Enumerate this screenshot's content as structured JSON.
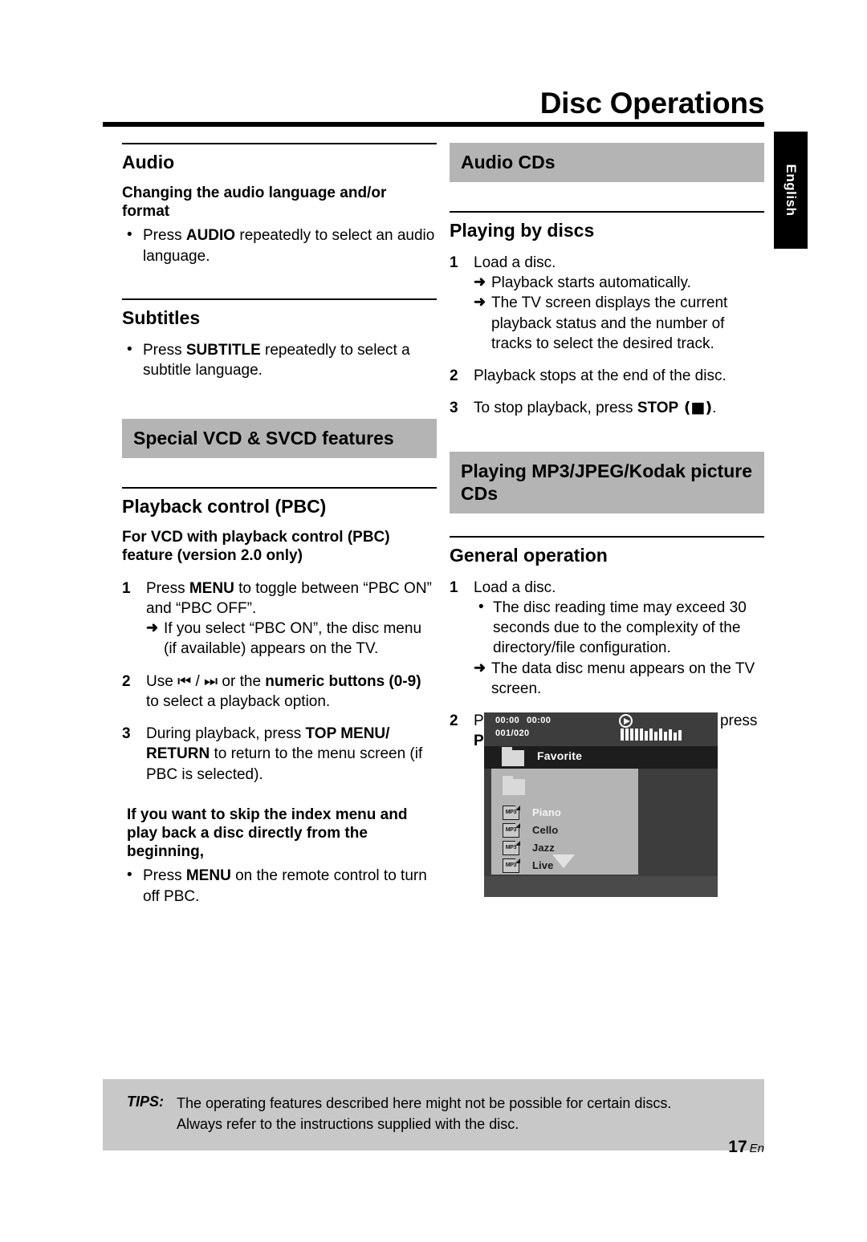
{
  "header": {
    "title": "Disc Operations",
    "language_tab": "English"
  },
  "left_column": {
    "audio": {
      "heading": "Audio",
      "sub_heading": "Changing the audio language and/or format",
      "bullet_pre": "Press ",
      "bullet_key": "AUDIO",
      "bullet_post": " repeatedly to select an audio language."
    },
    "subtitles": {
      "heading": "Subtitles",
      "bullet_pre": "Press ",
      "bullet_key": "SUBTITLE",
      "bullet_post": " repeatedly to select a subtitle language."
    },
    "special_band": "Special VCD & SVCD features",
    "pbc": {
      "heading": "Playback control (PBC)",
      "sub_heading": "For VCD with playback control (PBC) feature (version 2.0 only)",
      "step1_num": "1",
      "step1_pre": "Press ",
      "step1_key": "MENU",
      "step1_post": " to toggle between “PBC ON” and “PBC OFF”.",
      "step1_arrow": "If you select “PBC ON”, the disc menu (if available) appears on the TV.",
      "step2_num": "2",
      "step2_pre": "Use ",
      "step2_icon_prev": "⏮",
      "step2_sep": " / ",
      "step2_icon_next": "⏭",
      "step2_mid": " or the ",
      "step2_key": "numeric buttons (0-9)",
      "step2_post": " to select a playback option.",
      "step3_num": "3",
      "step3_pre": "During playback, press ",
      "step3_key": "TOP MENU/ RETURN",
      "step3_post": " to return to the menu screen (if PBC is selected).",
      "skip_heading": "If you want to skip the index menu and play back a disc directly from the beginning,",
      "skip_bullet_pre": "Press ",
      "skip_bullet_key": "MENU",
      "skip_bullet_post": " on the remote control to turn off PBC."
    }
  },
  "right_column": {
    "audio_cds_band": "Audio CDs",
    "playing_by_discs": {
      "heading": "Playing by discs",
      "step1_num": "1",
      "step1_text": "Load a disc.",
      "step1_arrow1": "Playback starts automatically.",
      "step1_arrow2": "The TV screen displays the current playback status and the number of tracks to select the desired track.",
      "step2_num": "2",
      "step2_text": "Playback stops at the end of the disc.",
      "step3_num": "3",
      "step3_pre": "To stop playback, press ",
      "step3_key": "STOP",
      "step3_symbol": " (■)",
      "step3_post": "."
    },
    "mp3_band": "Playing MP3/JPEG/Kodak picture CDs",
    "general_operation": {
      "heading": "General operation",
      "step1_num": "1",
      "step1_text": "Load a disc.",
      "step1_bullet": "The disc reading time may exceed 30 seconds due to the complexity of the directory/file configuration.",
      "step1_arrow": "The data disc menu appears on the TV screen.",
      "step2_num": "2",
      "step2_pre": "Playback starts automatically. If not, press ",
      "step2_key": "PLAY",
      "step2_symbol": " (▶)",
      "step2_post": "."
    }
  },
  "tv_mockup": {
    "time_elapsed": "00:00",
    "time_total": "00:00",
    "track_counter": "001/020",
    "play_icon": "play-icon",
    "selected_folder": "Favorite",
    "items": [
      {
        "icon": "mp3-file-icon",
        "icon_label": "MP3",
        "name": "Piano",
        "highlighted": true
      },
      {
        "icon": "mp3-file-icon",
        "icon_label": "MP3",
        "name": "Cello",
        "highlighted": false
      },
      {
        "icon": "mp3-file-icon",
        "icon_label": "MP3",
        "name": "Jazz",
        "highlighted": false
      },
      {
        "icon": "mp3-file-icon",
        "icon_label": "MP3",
        "name": "Live",
        "highlighted": false
      }
    ],
    "scroll_caret": "caret-down-icon"
  },
  "tips": {
    "label": "TIPS:",
    "line1": "The operating features described here might not be possible for certain discs.",
    "line2": "Always refer to the instructions supplied with the disc."
  },
  "footer": {
    "page_number": "17",
    "page_suffix": "En"
  },
  "colors": {
    "band_gray": "#b4b4b4",
    "tips_gray": "#c8c8c8",
    "tab_black": "#000000",
    "tv_dark": "#3d3d3d"
  }
}
